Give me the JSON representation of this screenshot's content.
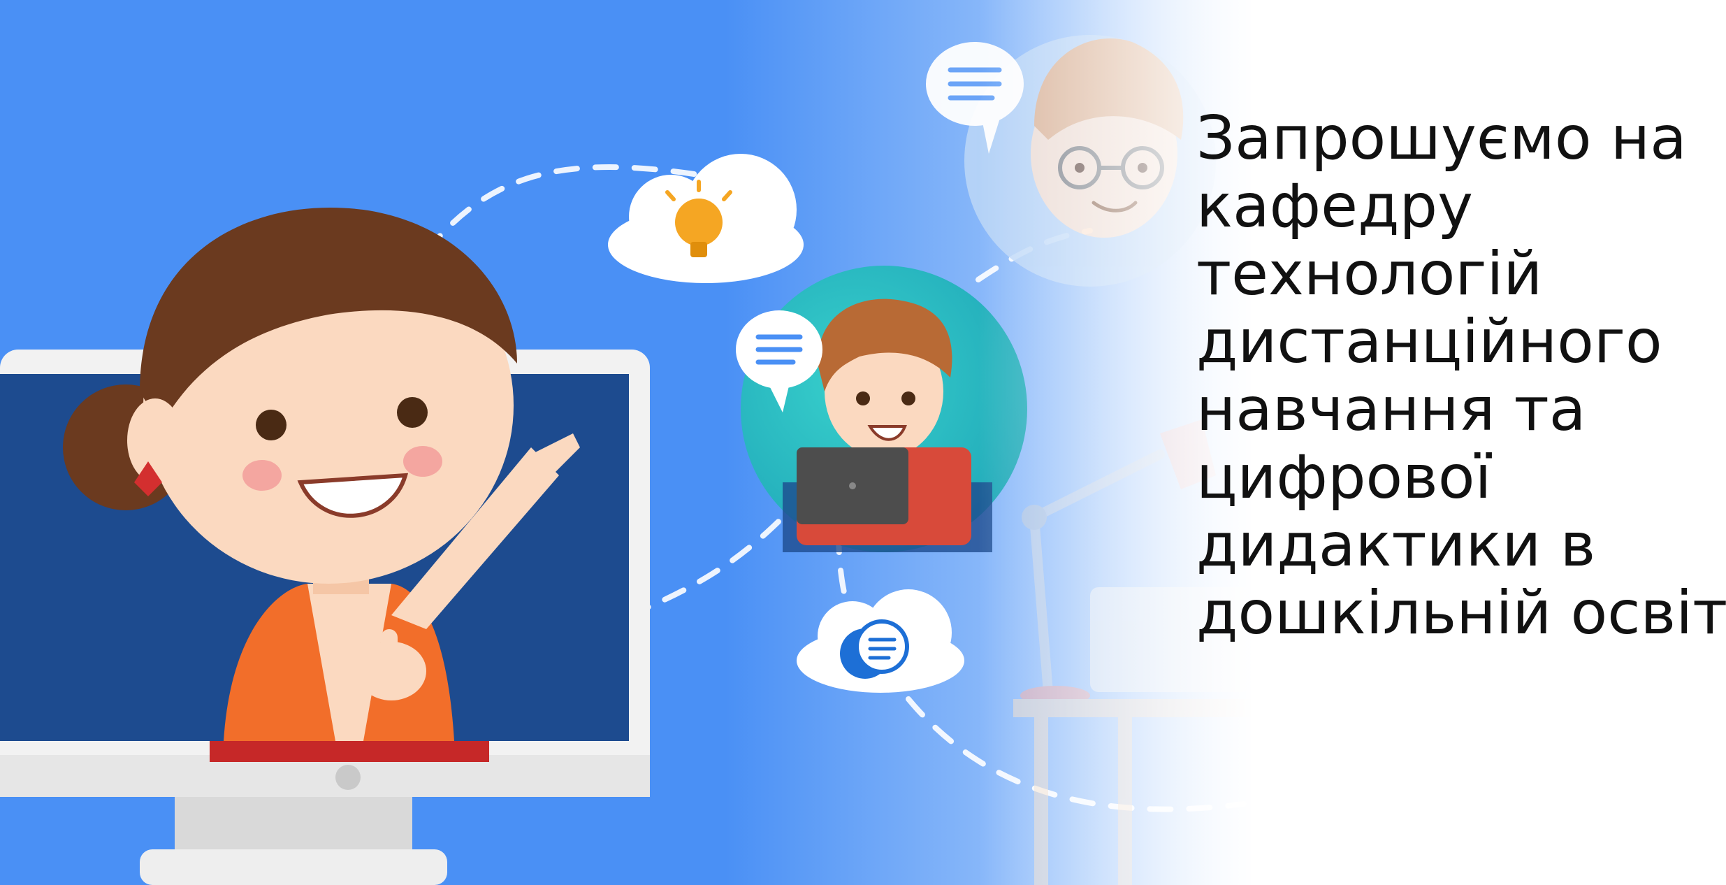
{
  "slide": {
    "headline_lines": [
      "Запрошуємо на",
      "кафедру",
      "технологій",
      "дистанційного",
      "навчання та",
      "цифрової",
      "дидактики в",
      "дошкільній освіті!"
    ]
  },
  "illustration": {
    "background_color": "#4a90f5",
    "fade_to_color": "#ffffff",
    "monitor_screen_color": "#1d4b8f",
    "monitor_frame_color": "#f2f2f2",
    "hair_color": "#6b3a1f",
    "skin_color": "#fbd9c0",
    "shirt_color": "#f26e2a",
    "icons": [
      "lightbulb-cloud-icon",
      "chat-bubble-icon",
      "chat-cloud-icon",
      "laptop-icon",
      "desk-lamp-icon"
    ]
  }
}
